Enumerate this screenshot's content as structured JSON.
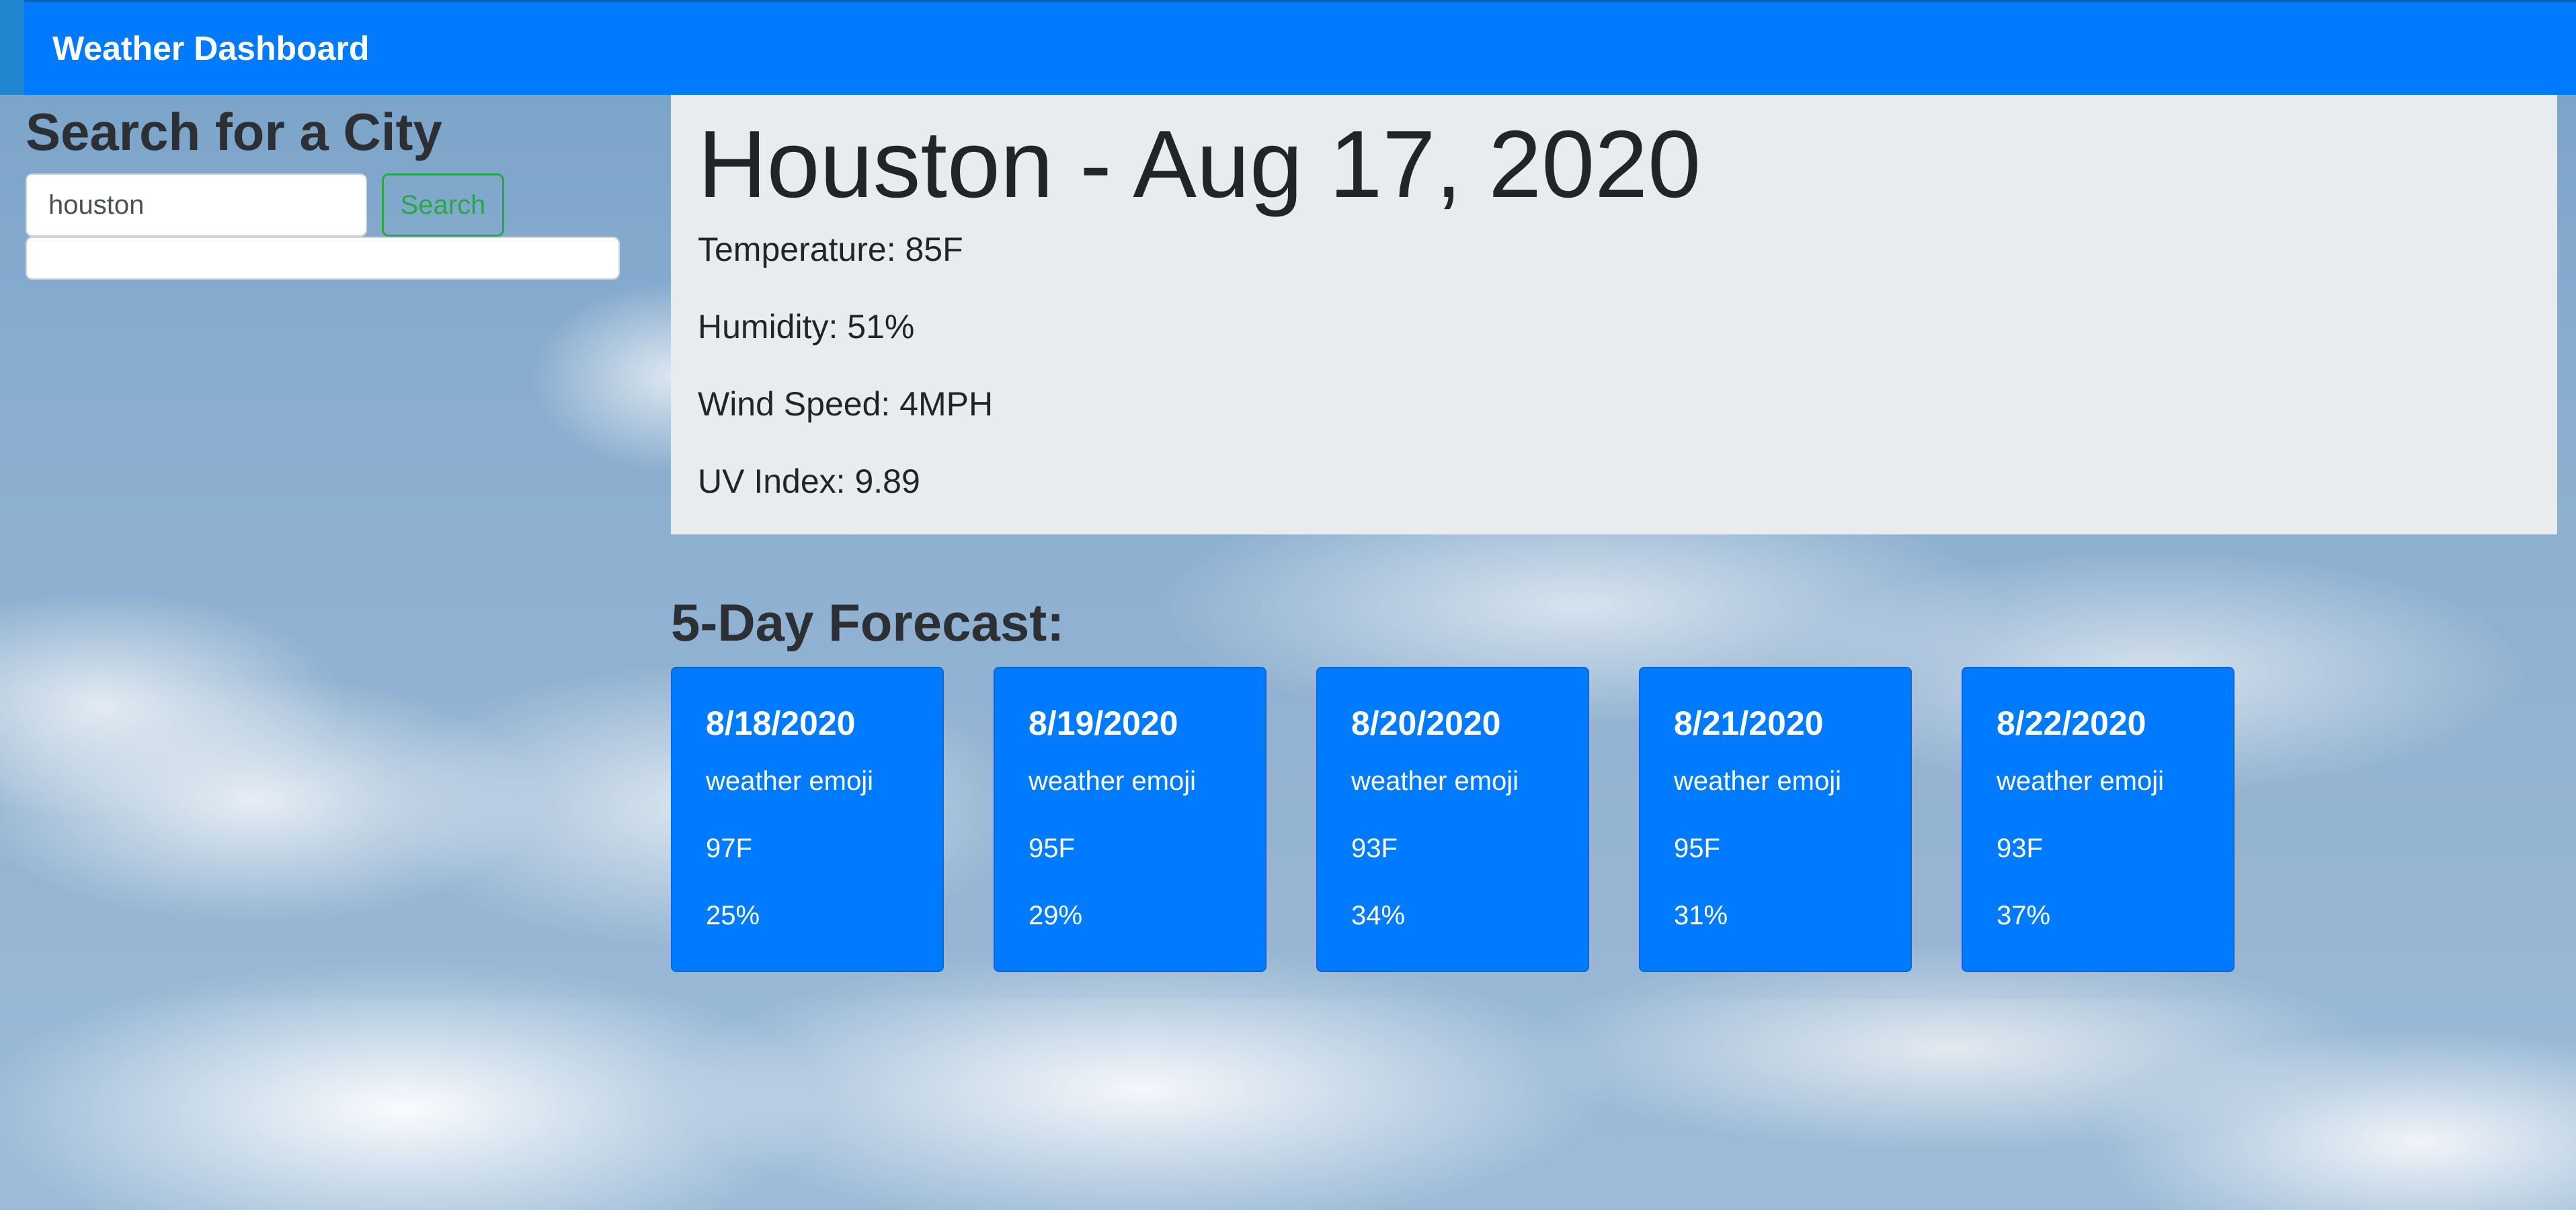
{
  "app": {
    "title": "Weather Dashboard"
  },
  "search": {
    "heading": "Search for a City",
    "input_value": "houston",
    "button_label": "Search"
  },
  "current": {
    "title": "Houston - Aug 17, 2020",
    "temperature": "Temperature: 85F",
    "humidity": "Humidity: 51%",
    "wind_speed": "Wind Speed: 4MPH",
    "uv_index": "UV Index: 9.89"
  },
  "forecast": {
    "heading": "5-Day Forecast:",
    "days": [
      {
        "date": "8/18/2020",
        "icon_text": "weather emoji",
        "temp": "97F",
        "humidity": "25%"
      },
      {
        "date": "8/19/2020",
        "icon_text": "weather emoji",
        "temp": "95F",
        "humidity": "29%"
      },
      {
        "date": "8/20/2020",
        "icon_text": "weather emoji",
        "temp": "93F",
        "humidity": "34%"
      },
      {
        "date": "8/21/2020",
        "icon_text": "weather emoji",
        "temp": "95F",
        "humidity": "31%"
      },
      {
        "date": "8/22/2020",
        "icon_text": "weather emoji",
        "temp": "93F",
        "humidity": "37%"
      }
    ]
  },
  "colors": {
    "navbar": "#007bff",
    "card": "#007bff",
    "jumbotron": "#e9ecef",
    "search_button": "#28a745"
  }
}
